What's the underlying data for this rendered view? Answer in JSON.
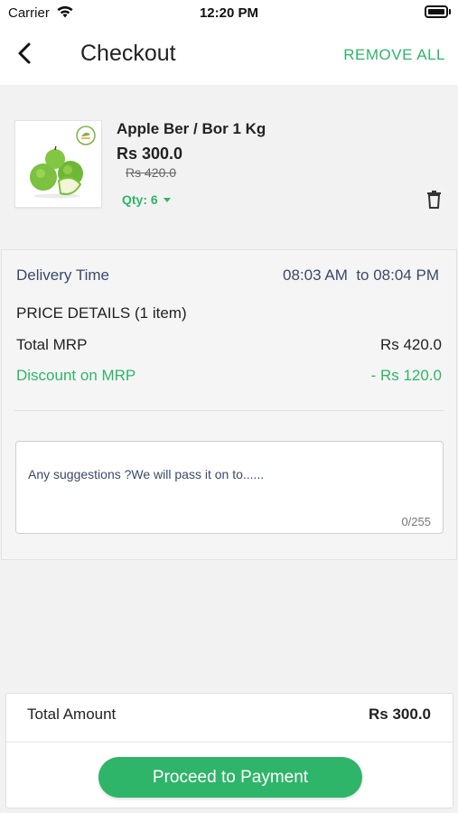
{
  "status_bar": {
    "carrier": "Carrier",
    "time": "12:20 PM"
  },
  "header": {
    "title": "Checkout",
    "remove_all_label": "REMOVE ALL"
  },
  "cart_item": {
    "name": "Apple Ber / Bor 1 Kg",
    "price": "Rs 300.0",
    "mrp": "Rs 420.0",
    "qty_label": "Qty: 6"
  },
  "details": {
    "delivery_label": "Delivery Time",
    "delivery_time": "08:03 AM  to 08:04 PM",
    "price_heading": "PRICE DETAILS (1 item)",
    "total_mrp_label": "Total MRP",
    "total_mrp_value": "Rs 420.0",
    "discount_label": "Discount on MRP",
    "discount_value": "- Rs 120.0"
  },
  "suggestions": {
    "placeholder": "Any suggestions ?We will pass it on to......",
    "counter": "0/255"
  },
  "footer": {
    "total_label": "Total Amount",
    "total_value": "Rs 300.0",
    "button_label": "Proceed to Payment"
  },
  "colors": {
    "accent": "#2fb56a",
    "muted_text": "#3a4a6a"
  },
  "icons": [
    "wifi-icon",
    "battery-icon",
    "back-arrow-icon",
    "brand-badge-icon",
    "caret-down-icon",
    "trash-icon"
  ]
}
